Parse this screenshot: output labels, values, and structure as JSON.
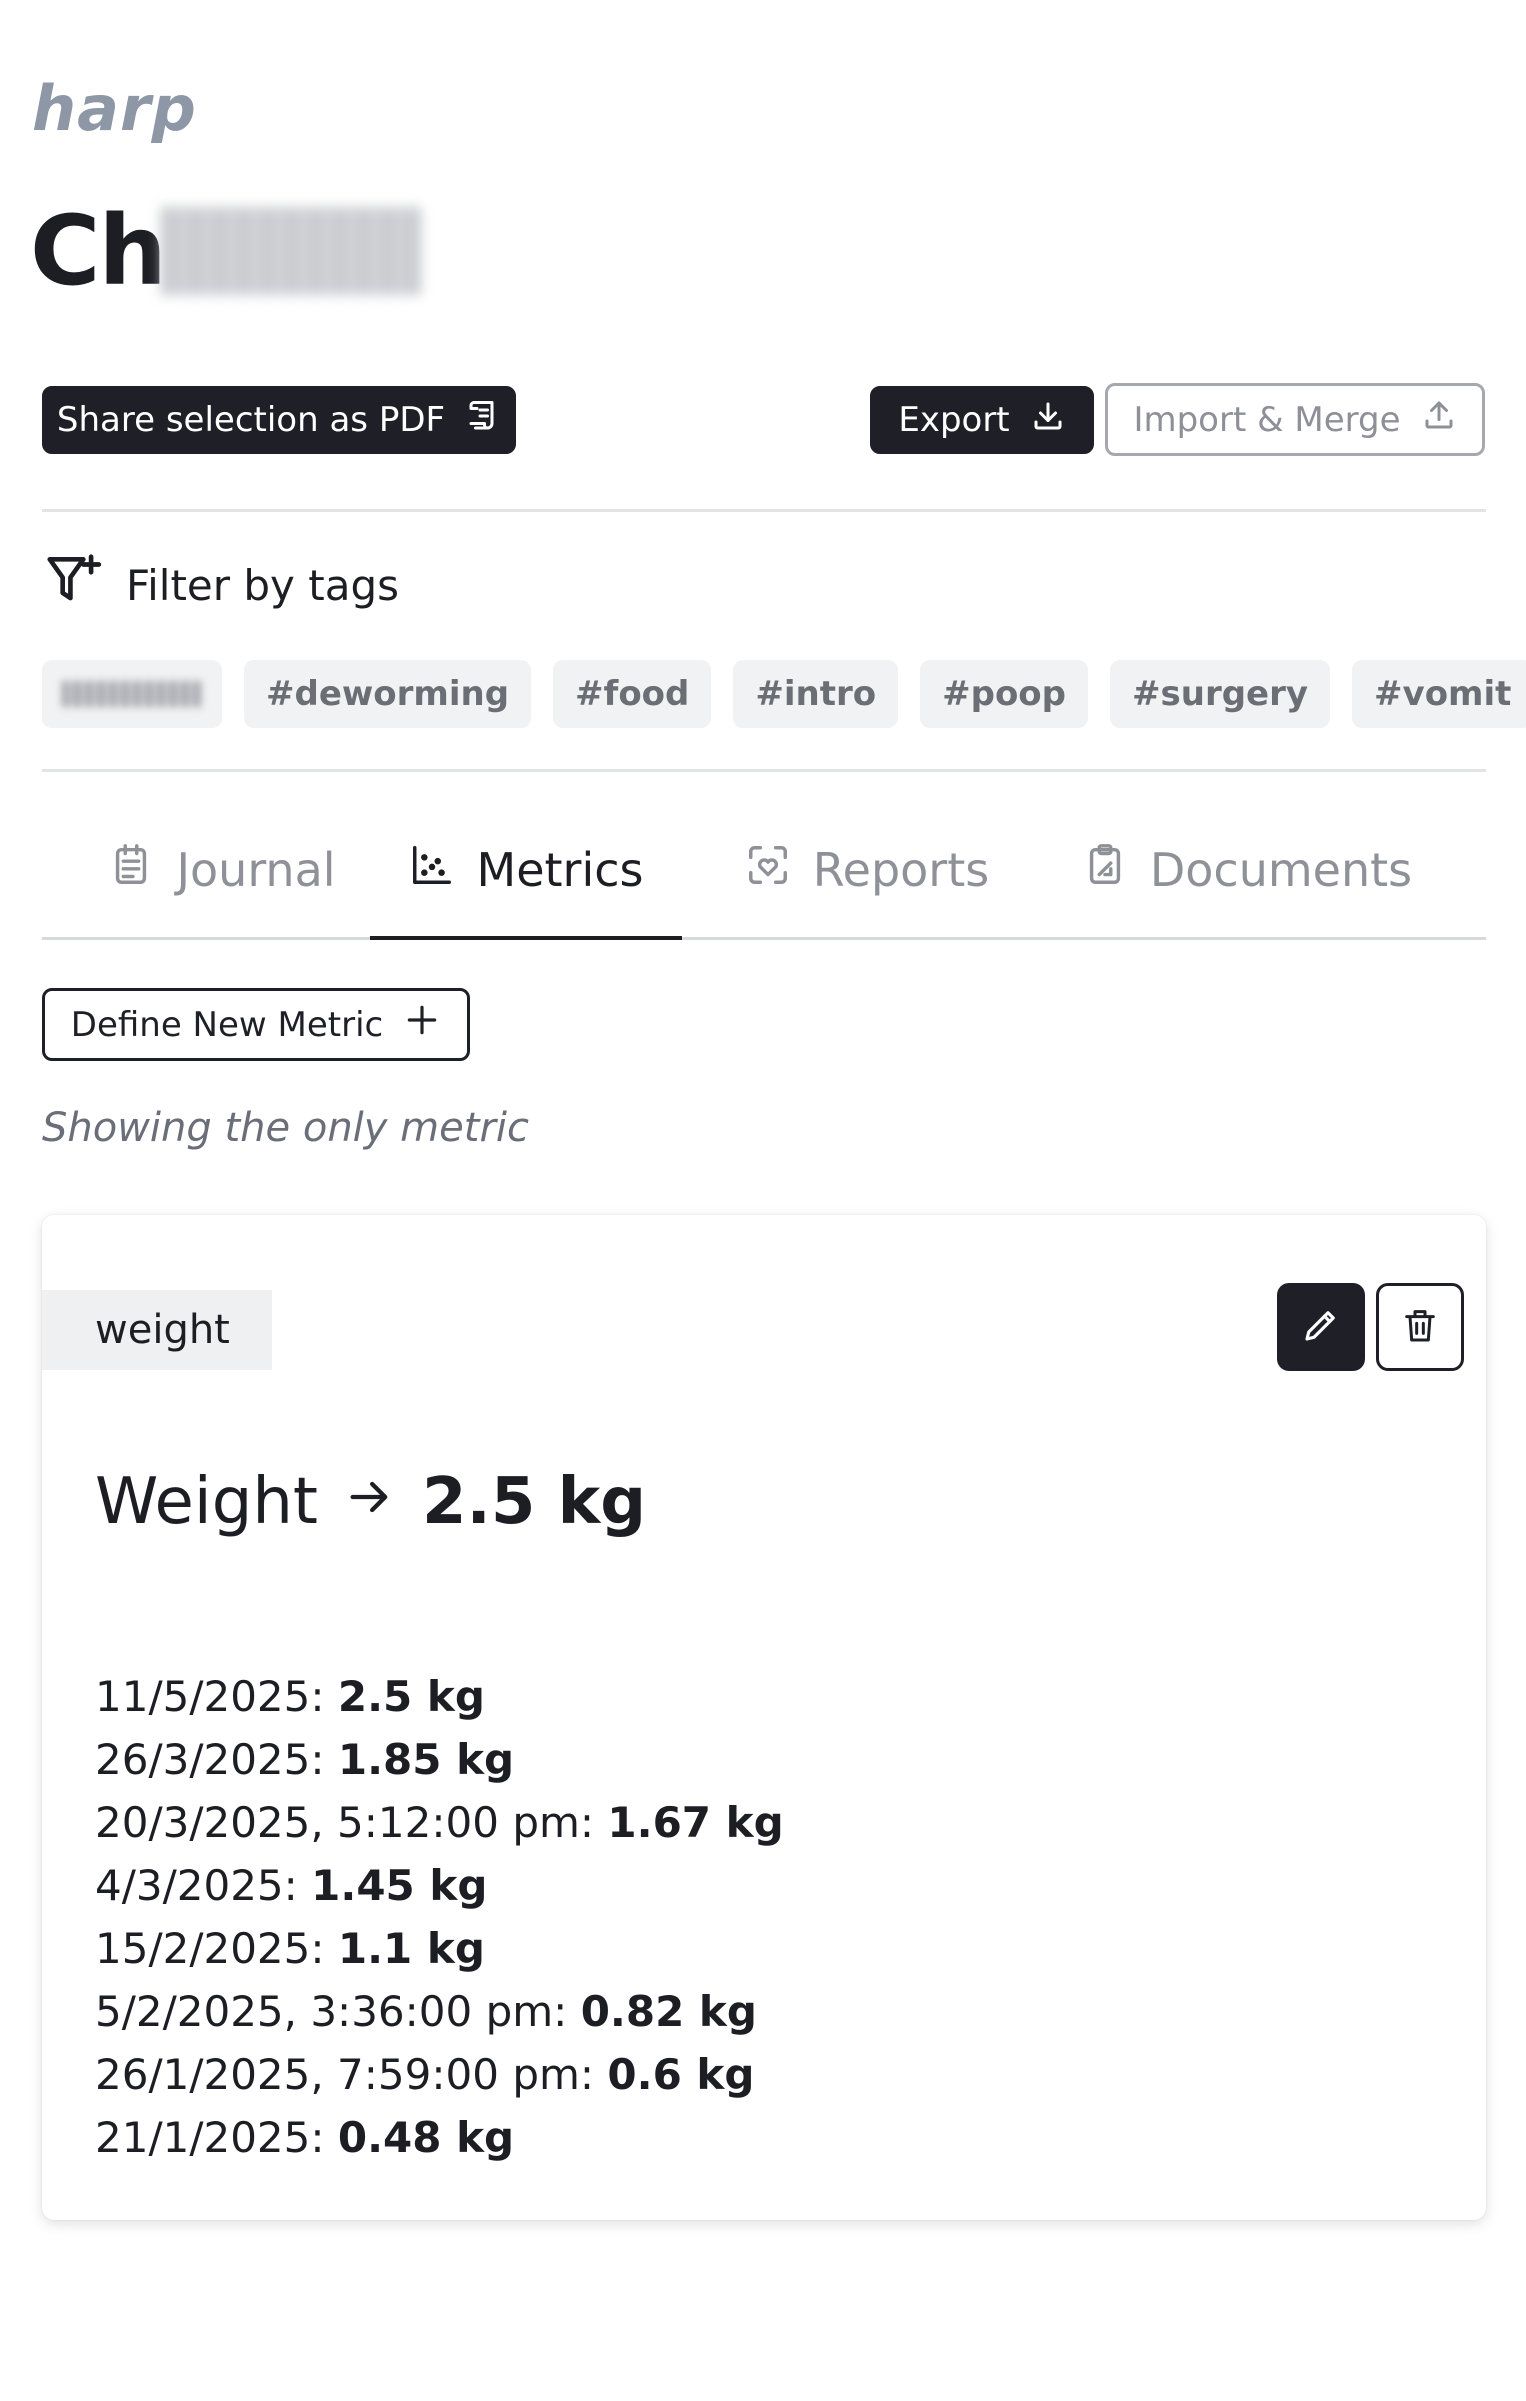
{
  "app": {
    "brand": "harp"
  },
  "pet": {
    "name_visible": "Ch"
  },
  "toolbar": {
    "share_pdf_label": "Share selection as PDF",
    "export_label": "Export",
    "import_label": "Import & Merge"
  },
  "filter": {
    "title": "Filter by tags",
    "tags": [
      "#deworming",
      "#food",
      "#intro",
      "#poop",
      "#surgery",
      "#vomit"
    ]
  },
  "tabs": [
    {
      "label": "Journal",
      "icon": "calendar-icon"
    },
    {
      "label": "Metrics",
      "icon": "scatter-chart-icon",
      "active": true
    },
    {
      "label": "Reports",
      "icon": "heart-scan-icon"
    },
    {
      "label": "Documents",
      "icon": "clipboard-icon"
    }
  ],
  "metrics": {
    "define_button_label": "Define New Metric",
    "note": "Showing the only metric",
    "card": {
      "tag": "weight",
      "title": "Weight",
      "latest_value": "2.5 kg",
      "entries": [
        {
          "date": "11/5/2025:",
          "value": "2.5 kg"
        },
        {
          "date": "26/3/2025:",
          "value": "1.85 kg"
        },
        {
          "date": "20/3/2025, 5:12:00 pm:",
          "value": "1.67 kg"
        },
        {
          "date": "4/3/2025:",
          "value": "1.45 kg"
        },
        {
          "date": "15/2/2025:",
          "value": "1.1 kg"
        },
        {
          "date": "5/2/2025, 3:36:00 pm:",
          "value": "0.82 kg"
        },
        {
          "date": "26/1/2025, 7:59:00 pm:",
          "value": "0.6 kg"
        },
        {
          "date": "21/1/2025:",
          "value": "0.48 kg"
        }
      ]
    }
  }
}
